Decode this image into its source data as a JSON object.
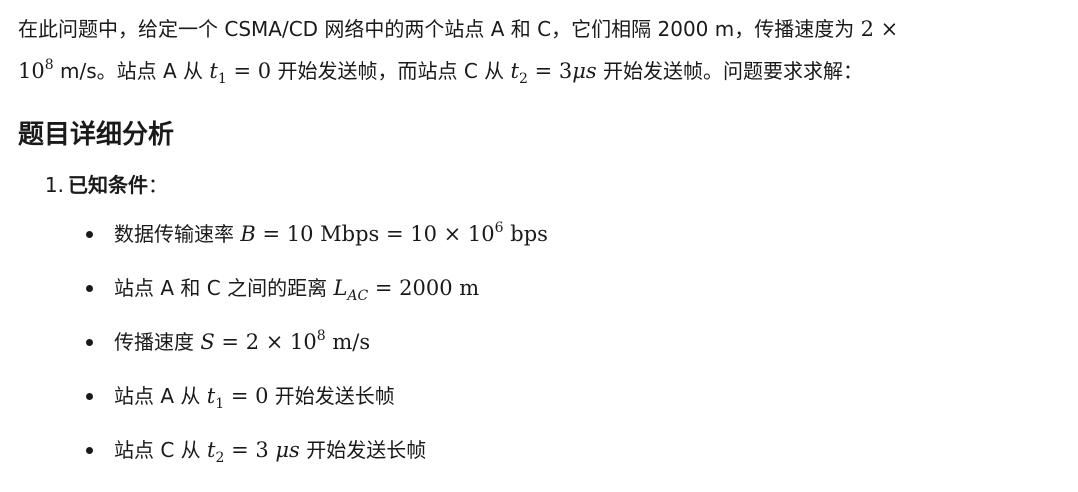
{
  "intro": {
    "line1": {
      "text": "在此问题中，给定一个 CSMA/CD 网络中的两个站点 A 和 C，它们相隔 2000 m，传播速度为 ",
      "math": "2 ×"
    },
    "line2": {
      "base": "10",
      "exp": "8",
      "after_pow": " m/s。站点 A 从 ",
      "t1_var": "t",
      "t1_sub": "1",
      "t1_eq": " = 0",
      "mid": " 开始发送帧，而站点 C 从 ",
      "t2_var": "t",
      "t2_sub": "2",
      "t2_eq": " = 3",
      "t2_unit": "μs",
      "end": " 开始发送帧。问题要求求解："
    }
  },
  "section": {
    "title": "题目详细分析"
  },
  "item1": {
    "number": "1.",
    "label": "已知条件",
    "colon": "："
  },
  "bullets": {
    "b1": {
      "text": "数据传输速率 ",
      "var": "B",
      "eq": " = 10 Mbps = 10 × 10",
      "exp": "6",
      "unit": " bps"
    },
    "b2": {
      "text": "站点 A 和 C 之间的距离 ",
      "var": "L",
      "sub": "AC",
      "eq": " = 2000 m"
    },
    "b3": {
      "text": "传播速度 ",
      "var": "S",
      "eq": " = 2 × 10",
      "exp": "8",
      "unit": " m/s"
    },
    "b4": {
      "text": "站点 A 从 ",
      "var": "t",
      "sub": "1",
      "eq": " = 0",
      "after": " 开始发送长帧"
    },
    "b5": {
      "text": "站点 C 从 ",
      "var": "t",
      "sub": "2",
      "eq": " = 3 ",
      "unit": "μs",
      "after": " 开始发送长帧"
    }
  }
}
